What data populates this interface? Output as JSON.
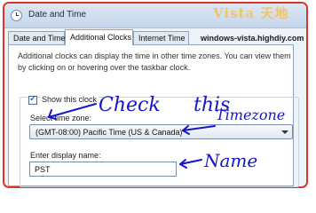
{
  "window": {
    "title": "Date and Time"
  },
  "watermark": {
    "title": "Vista 天地",
    "url": "windows-vista.highdiy.com"
  },
  "tabs": [
    {
      "label": "Date and Time"
    },
    {
      "label": "Additional Clocks"
    },
    {
      "label": "Internet Time"
    }
  ],
  "content": {
    "intro": "Additional clocks can display the time in other time zones. You can view them by clicking on or hovering over the taskbar clock.",
    "clock": {
      "show_label": "Show this clock",
      "checked": true,
      "timezone_label": "Select time zone:",
      "timezone_value": "(GMT-08:00) Pacific Time (US & Canada)",
      "display_name_label": "Enter display name:",
      "display_name_value": "PST"
    }
  },
  "annotations": {
    "check": "Check",
    "this": "this",
    "timezone": "Timezone",
    "name": "Name",
    "color": "#1515c9"
  },
  "colors": {
    "highlight_border": "#d9352b",
    "watermark_title": "#f2c46a"
  }
}
